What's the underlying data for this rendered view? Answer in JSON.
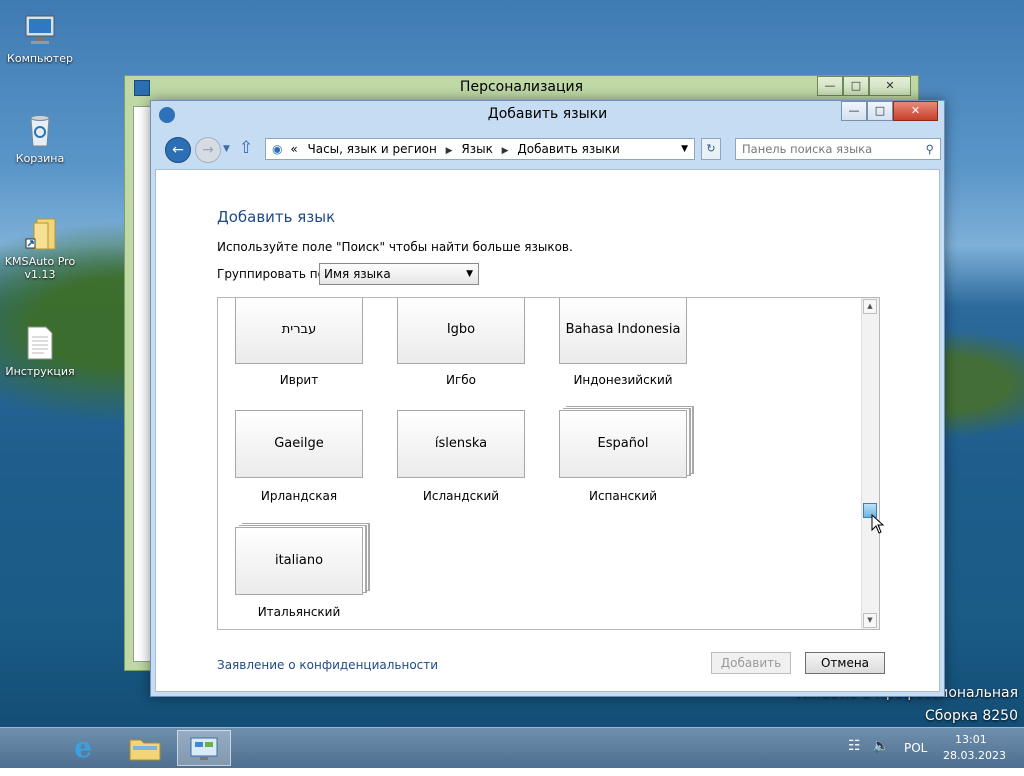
{
  "desktop": {
    "icons": [
      {
        "label": "Компьютер"
      },
      {
        "label": "Корзина"
      },
      {
        "label": "KMSAuto Pro v1.13"
      },
      {
        "label": "Инструкция"
      }
    ],
    "watermark_line1": "Windows 8 Профессиональная",
    "watermark_line2": "Сборка 8250"
  },
  "background_window": {
    "title": "Персонализация"
  },
  "window": {
    "title": "Добавить языки",
    "address": {
      "prefix": "«",
      "crumbs": [
        "Часы, язык и регион",
        "Язык",
        "Добавить языки"
      ]
    },
    "search_placeholder": "Панель поиска языка",
    "heading": "Добавить язык",
    "description": "Используйте поле \"Поиск\" чтобы найти больше языков.",
    "group_by_label": "Группировать по:",
    "group_by_value": "Имя языка",
    "languages": [
      {
        "native": "עברית",
        "name": "Иврит"
      },
      {
        "native": "Igbo",
        "name": "Игбо"
      },
      {
        "native": "Bahasa Indonesia",
        "name": "Индонезийский"
      },
      {
        "native": "Gaeilge",
        "name": "Ирландская"
      },
      {
        "native": "íslenska",
        "name": "Исландский"
      },
      {
        "native": "Español",
        "name": "Испанский"
      },
      {
        "native": "italiano",
        "name": "Итальянский"
      }
    ],
    "privacy_link": "Заявление о конфиденциальности",
    "add_button": "Добавить",
    "cancel_button": "Отмена"
  },
  "taskbar": {
    "language": "POL",
    "time": "13:01",
    "date": "28.03.2023"
  },
  "colors": {
    "link": "#1f4a86",
    "title_bar": "#c6dcf2",
    "taskbar": "#5a7a9b"
  }
}
